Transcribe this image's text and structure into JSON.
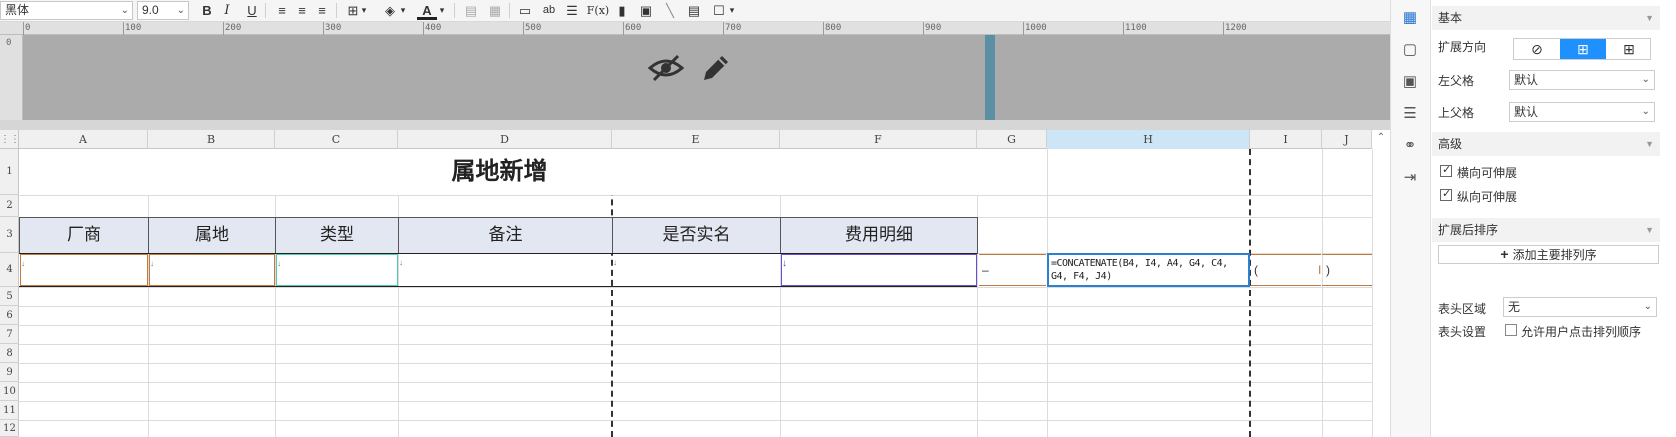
{
  "toolbar": {
    "font_family": "黑体",
    "font_size": "9.0",
    "bold": "B",
    "italic": "I",
    "underline": "U",
    "text_btn": "ab",
    "formula_btn": "F(x)"
  },
  "ruler": {
    "ticks": [
      "0",
      "100",
      "200",
      "300",
      "400",
      "500",
      "600",
      "700",
      "800",
      "900",
      "1000",
      "1100",
      "1200"
    ],
    "vtick": "0"
  },
  "grid": {
    "columns": [
      "A",
      "B",
      "C",
      "D",
      "E",
      "F",
      "G",
      "H",
      "I",
      "J"
    ],
    "rows": [
      "1",
      "2",
      "3",
      "4",
      "5",
      "6",
      "7",
      "8",
      "9",
      "10",
      "11",
      "12"
    ],
    "title": "属地新增",
    "headers": [
      "厂商",
      "属地",
      "类型",
      "备注",
      "是否实名",
      "费用明细"
    ],
    "g4": "–",
    "h4_formula": "=CONCATENATE(B4, I4, A4, G4, C4, G4, F4, J4)",
    "i4": "(",
    "j4": ")"
  },
  "panel": {
    "basic": "基本",
    "expand_dir": "扩展方向",
    "left_parent": "左父格",
    "left_parent_value": "默认",
    "top_parent": "上父格",
    "top_parent_value": "默认",
    "advanced": "高级",
    "h_stretch": "横向可伸展",
    "v_stretch": "纵向可伸展",
    "sort_after": "扩展后排序",
    "add_sort": "添加主要排列序",
    "header_area": "表头区域",
    "header_area_value": "无",
    "header_settings": "表头设置",
    "allow_sort": "允许用户点击排列顺序"
  },
  "colors": {
    "accent": "#1e90ff",
    "header_fill": "#e3e7f1",
    "preview_band": "#ababab"
  }
}
